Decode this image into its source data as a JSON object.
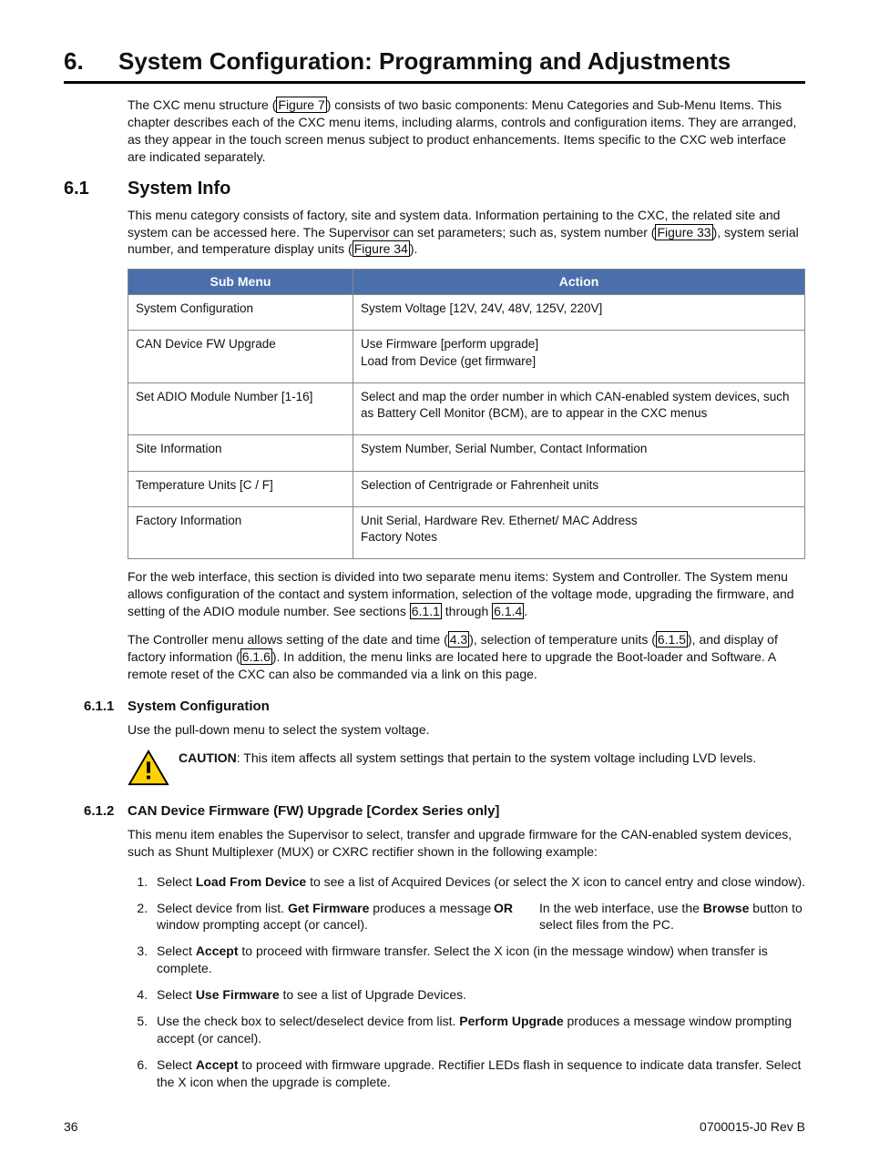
{
  "chapter": {
    "num": "6.",
    "title": "System Configuration: Programming and Adjustments"
  },
  "intro": {
    "pre": "The CXC menu structure (",
    "link1": "Figure 7",
    "post": ") consists of two basic components: Menu Categories and Sub-Menu Items. This chapter describes each of the CXC menu items, including alarms, controls and configuration items. They are arranged, as they appear in the touch screen menus subject to product enhancements. Items specific to the CXC web interface are indicated separately."
  },
  "s61": {
    "num": "6.1",
    "title": "System Info",
    "p1a": "This menu category consists of factory, site and system data. Information pertaining to the CXC, the related site and system can be accessed here. The Supervisor can set parameters; such as, system number (",
    "link1": "Figure 33",
    "p1b": "), system serial number, and temperature display units (",
    "link2": "Figure 34",
    "p1c": ")."
  },
  "table": {
    "h1": "Sub Menu",
    "h2": "Action",
    "rows": [
      {
        "sub": "System Configuration",
        "act": "System Voltage [12V, 24V, 48V, 125V, 220V]"
      },
      {
        "sub": "CAN Device FW Upgrade",
        "act": "Use Firmware [perform upgrade]\nLoad from Device (get firmware]"
      },
      {
        "sub": "Set ADIO Module Number [1-16]",
        "act": "Select and map the order number in which CAN-enabled system devices, such as Battery Cell Monitor (BCM), are to appear in the CXC menus"
      },
      {
        "sub": "Site Information",
        "act": "System Number, Serial Number, Contact Information"
      },
      {
        "sub": "Temperature Units [C / F]",
        "act": "Selection of Centrigrade or Fahrenheit units"
      },
      {
        "sub": "Factory Information",
        "act": "Unit Serial, Hardware Rev. Ethernet/ MAC Address\nFactory Notes"
      }
    ]
  },
  "afterTable": {
    "p1a": "For the web interface, this section is divided into two separate menu items: System and Controller. The System menu allows configuration of the contact and system information, selection of the voltage mode, upgrading the firmware, and setting of the ADIO module number. See sections ",
    "link1": "6.1.1",
    "p1b": " through ",
    "link2": "6.1.4",
    "p1c": ".",
    "p2a": "The Controller menu allows setting of the date and time (",
    "link3": "4.3",
    "p2b": "), selection of temperature units (",
    "link4": "6.1.5",
    "p2c": "), and display of factory information (",
    "link5": "6.1.6",
    "p2d": "). In addition, the menu links are located here to upgrade the Boot-loader and Software. A remote reset of the CXC can also be commanded via a link on this page."
  },
  "s611": {
    "num": "6.1.1",
    "title": "System Configuration",
    "p1": "Use the pull-down menu to select the system voltage.",
    "cautionLabel": "CAUTION",
    "cautionText": ": This item affects all system settings that pertain to the system voltage including LVD levels."
  },
  "s612": {
    "num": "6.1.2",
    "title": "CAN Device Firmware (FW) Upgrade [Cordex Series only]",
    "p1": "This menu item enables the Supervisor to select, transfer and upgrade firmware for the CAN-enabled system devices, such as Shunt Multiplexer (MUX) or CXRC rectifier shown in the following example:",
    "steps": {
      "s1a": "Select ",
      "s1b": "Load From Device",
      "s1c": " to see a list of Acquired Devices (or select the X icon to cancel entry and close window).",
      "s2a": "Select device from list. ",
      "s2b": "Get Firmware",
      "s2c": " produces a message window prompting accept (or cancel).",
      "s2or": "OR",
      "s2ra": "In the web interface, use the ",
      "s2rb": "Browse",
      "s2rc": " button to select files from the PC.",
      "s3a": "Select ",
      "s3b": "Accept",
      "s3c": " to proceed with firmware transfer. Select the X icon (in the message window) when transfer is complete.",
      "s4a": "Select ",
      "s4b": "Use Firmware",
      "s4c": " to see a list of Upgrade Devices.",
      "s5a": "Use the check box to select/deselect device from list. ",
      "s5b": "Perform Upgrade",
      "s5c": " produces a message window prompting accept (or cancel).",
      "s6a": "Select ",
      "s6b": "Accept",
      "s6c": " to proceed with firmware upgrade. Rectifier LEDs flash in sequence to indicate data transfer. Select the X icon when the upgrade is complete."
    }
  },
  "footer": {
    "page": "36",
    "doc": "0700015-J0    Rev B"
  }
}
